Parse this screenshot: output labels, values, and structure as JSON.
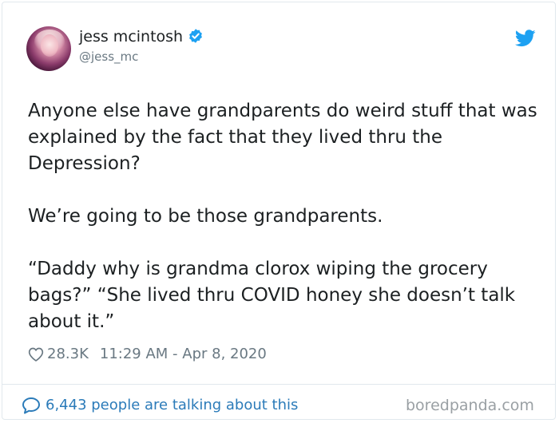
{
  "author": {
    "name": "jess mcintosh",
    "handle": "@jess_mc",
    "verified": true
  },
  "tweet": {
    "paragraphs": [
      "Anyone else have grandparents do weird stuff that was explained by the fact that they lived thru the Depression?",
      "We’re going to be those grandparents.",
      "“Daddy why is grandma clorox wiping the grocery bags?” “She lived thru COVID honey she doesn’t talk about it.”"
    ],
    "likes": "28.3K",
    "timestamp": "11:29 AM - Apr 8, 2020"
  },
  "footer": {
    "talking": "6,443 people are talking about this",
    "watermark": "boredpanda.com"
  },
  "icons": {
    "verified": "verified-badge-icon",
    "bird": "twitter-bird-icon",
    "heart": "heart-outline-icon",
    "bubble": "speech-bubble-icon"
  },
  "colors": {
    "accent": "#1da1f2",
    "link": "#2b7bb9",
    "muted": "#697882",
    "text": "#1c2022"
  }
}
